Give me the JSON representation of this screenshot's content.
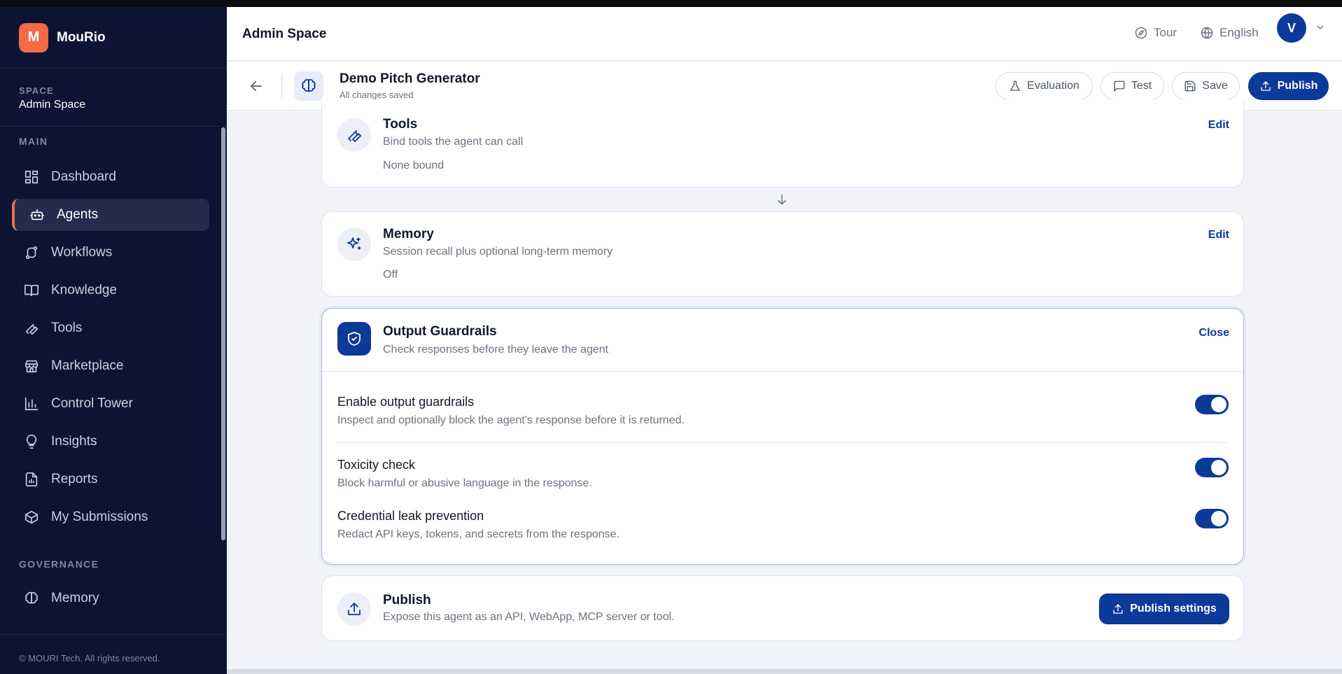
{
  "sidebar": {
    "brand_letter": "M",
    "brand_name": "MouRio",
    "space_label": "SPACE",
    "space_value": "Admin Space",
    "main_label": "MAIN",
    "governance_label": "GOVERNANCE",
    "items": [
      {
        "label": "Dashboard",
        "icon": "dashboard-icon"
      },
      {
        "label": "Agents",
        "icon": "robot-icon"
      },
      {
        "label": "Workflows",
        "icon": "workflow-icon"
      },
      {
        "label": "Knowledge",
        "icon": "book-icon"
      },
      {
        "label": "Tools",
        "icon": "wrench-icon"
      },
      {
        "label": "Marketplace",
        "icon": "store-icon"
      },
      {
        "label": "Control Tower",
        "icon": "bar-chart-icon"
      },
      {
        "label": "Insights",
        "icon": "lightbulb-icon"
      },
      {
        "label": "Reports",
        "icon": "report-icon"
      },
      {
        "label": "My Submissions",
        "icon": "package-icon"
      }
    ],
    "governance_items": [
      {
        "label": "Memory",
        "icon": "brain-icon"
      }
    ],
    "footer": "© MOURI Tech. All rights reserved."
  },
  "header": {
    "title": "Admin Space",
    "tour": "Tour",
    "language": "English",
    "avatar_letter": "V"
  },
  "subheader": {
    "agent_name": "Demo Pitch Generator",
    "status": "All changes saved",
    "evaluation": "Evaluation",
    "test": "Test",
    "save": "Save",
    "publish": "Publish"
  },
  "cards": {
    "tools": {
      "title": "Tools",
      "subtitle": "Bind tools the agent can call",
      "value": "None bound",
      "action": "Edit"
    },
    "memory": {
      "title": "Memory",
      "subtitle": "Session recall plus optional long-term memory",
      "value": "Off",
      "action": "Edit"
    },
    "guardrails": {
      "title": "Output Guardrails",
      "subtitle": "Check responses before they leave the agent",
      "action": "Close",
      "rows": [
        {
          "title": "Enable output guardrails",
          "desc": "Inspect and optionally block the agent's response before it is returned.",
          "on": true
        },
        {
          "title": "Toxicity check",
          "desc": "Block harmful or abusive language in the response.",
          "on": true
        },
        {
          "title": "Credential leak prevention",
          "desc": "Redact API keys, tokens, and secrets from the response.",
          "on": true
        }
      ]
    },
    "publish": {
      "title": "Publish",
      "subtitle": "Expose this agent as an API, WebApp, MCP server or tool.",
      "action": "Publish settings"
    }
  },
  "colors": {
    "primary": "#0c3a99",
    "accent": "#f26b44",
    "sidebar_bg": "#0d1433"
  }
}
